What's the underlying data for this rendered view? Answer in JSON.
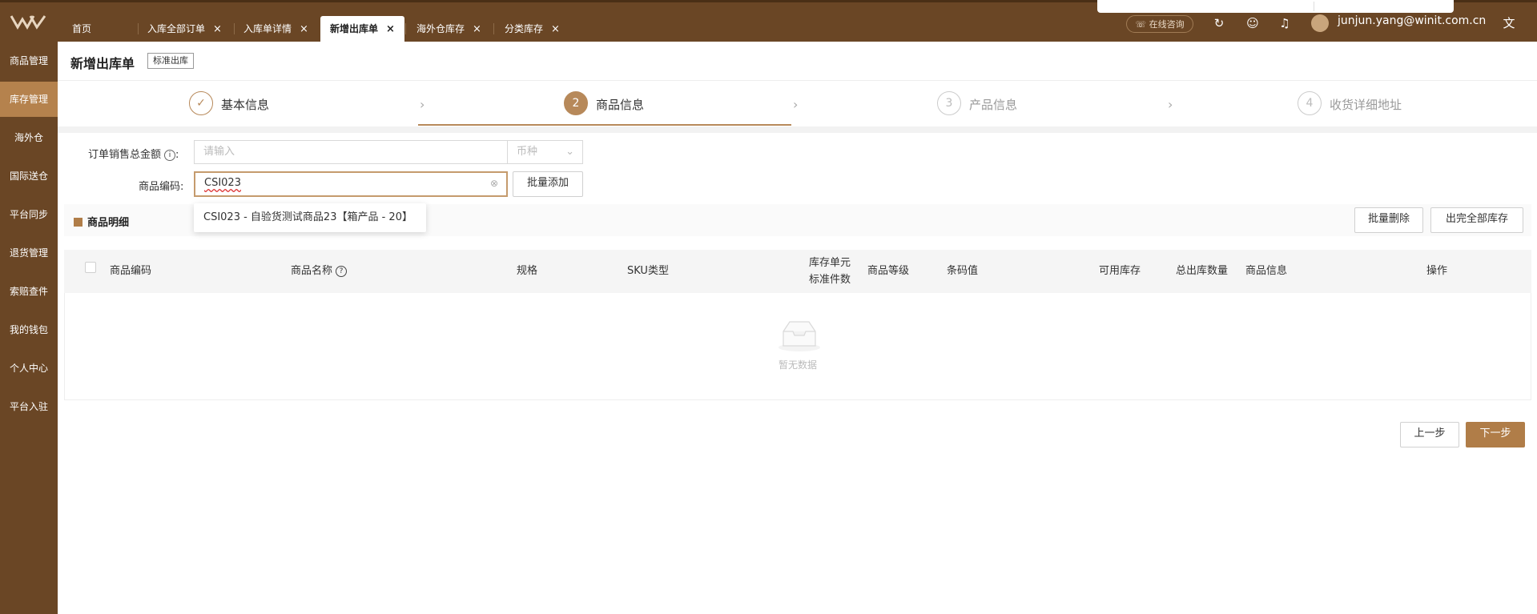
{
  "brand": {
    "accent": "#6a4625",
    "highlight": "#b07d48"
  },
  "sidebar": {
    "items": [
      {
        "label": "商品管理"
      },
      {
        "label": "库存管理",
        "active": true
      },
      {
        "label": "海外仓"
      },
      {
        "label": "国际送仓"
      },
      {
        "label": "平台同步"
      },
      {
        "label": "退货管理"
      },
      {
        "label": "索赔查件"
      },
      {
        "label": "我的钱包"
      },
      {
        "label": "个人中心"
      },
      {
        "label": "平台入驻"
      }
    ]
  },
  "tabs": [
    {
      "label": "首页",
      "closable": false
    },
    {
      "label": "入库全部订单",
      "closable": true
    },
    {
      "label": "入库单详情",
      "closable": true
    },
    {
      "label": "新增出库单",
      "closable": true,
      "active": true
    },
    {
      "label": "海外仓库存",
      "closable": true
    },
    {
      "label": "分类库存",
      "closable": true
    }
  ],
  "header": {
    "chat_label": "在线咨询",
    "user_email": "junjun.yang@winit.com.cn",
    "icons": [
      "refresh-icon",
      "smile-icon",
      "bell-icon",
      "translate-icon"
    ]
  },
  "page": {
    "title": "新增出库单",
    "type_badge": "标准出库"
  },
  "steps": [
    {
      "number": "✓",
      "label": "基本信息",
      "state": "done"
    },
    {
      "number": "2",
      "label": "商品信息",
      "state": "active"
    },
    {
      "number": "3",
      "label": "产品信息",
      "state": "pending"
    },
    {
      "number": "4",
      "label": "收货详细地址",
      "state": "pending"
    }
  ],
  "form": {
    "total_amount_label": "订单销售总金额",
    "total_amount_placeholder": "请输入",
    "currency_placeholder": "币种",
    "product_code_label": "商品编码:",
    "product_code_value": "CSI023",
    "batch_add_label": "批量添加",
    "suggestion": "CSI023 - 自验货测试商品23【箱产品 - 20】"
  },
  "detail": {
    "title": "商品明细",
    "batch_delete_label": "批量删除",
    "ship_all_label": "出完全部库存"
  },
  "table": {
    "columns": [
      "商品编码",
      "商品名称",
      "规格",
      "SKU类型",
      "库存单元",
      "标准件数",
      "商品等级",
      "条码值",
      "可用库存",
      "总出库数量",
      "商品信息",
      "操作"
    ],
    "empty_text": "暂无数据"
  },
  "footer": {
    "prev_label": "上一步",
    "next_label": "下一步"
  }
}
